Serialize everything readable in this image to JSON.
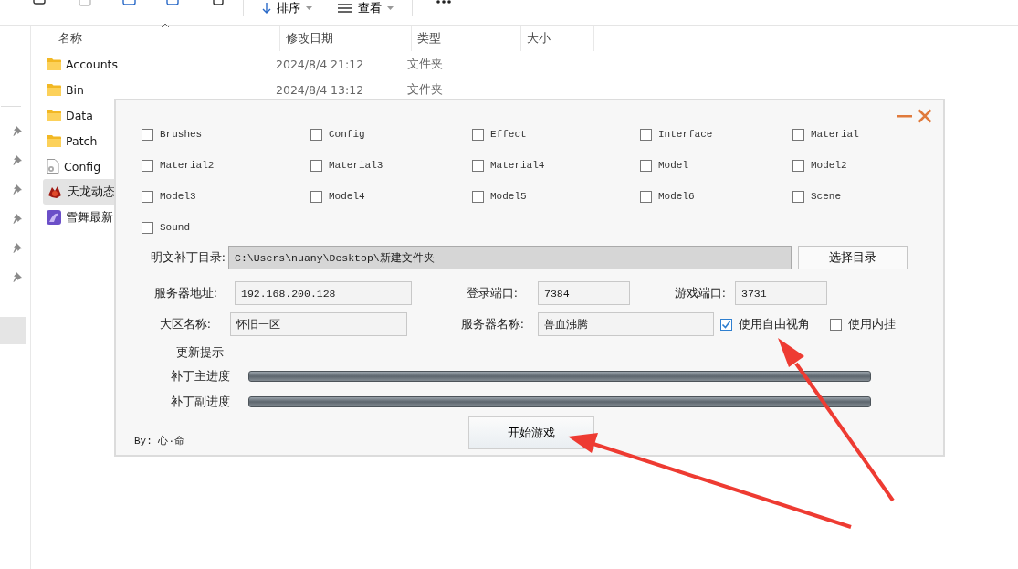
{
  "toolbar": {
    "items": [
      {
        "label": "排序"
      },
      {
        "label": "查看"
      }
    ]
  },
  "explorer": {
    "columns": [
      "名称",
      "修改日期",
      "类型",
      "大小"
    ],
    "rows": [
      {
        "name": "Accounts",
        "modified": "2024/8/4 21:12",
        "type": "文件夹",
        "kind": "folder",
        "selected": false
      },
      {
        "name": "Bin",
        "modified": "2024/8/4 13:12",
        "type": "文件夹",
        "kind": "folder",
        "selected": false
      },
      {
        "name": "Data",
        "kind": "folder",
        "selected": false
      },
      {
        "name": "Patch",
        "kind": "folder",
        "selected": false
      },
      {
        "name": "Config",
        "kind": "config",
        "selected": false
      },
      {
        "name": "天龙动态",
        "kind": "game",
        "selected": true
      },
      {
        "name": "雪舞最新",
        "kind": "app",
        "selected": false
      }
    ]
  },
  "dialog": {
    "checkboxes": [
      {
        "label": "Brushes",
        "checked": false
      },
      {
        "label": "Config",
        "checked": false
      },
      {
        "label": "Effect",
        "checked": false
      },
      {
        "label": "Interface",
        "checked": false
      },
      {
        "label": "Material",
        "checked": false
      },
      {
        "label": "Material2",
        "checked": false
      },
      {
        "label": "Material3",
        "checked": false
      },
      {
        "label": "Material4",
        "checked": false
      },
      {
        "label": "Model",
        "checked": false
      },
      {
        "label": "Model2",
        "checked": false
      },
      {
        "label": "Model3",
        "checked": false
      },
      {
        "label": "Model4",
        "checked": false
      },
      {
        "label": "Model5",
        "checked": false
      },
      {
        "label": "Model6",
        "checked": false
      },
      {
        "label": "Scene",
        "checked": false
      },
      {
        "label": "Sound",
        "checked": false
      }
    ],
    "patch_dir": {
      "label": "明文补丁目录:",
      "value": "C:\\Users\\nuany\\Desktop\\新建文件夹",
      "button": "选择目录"
    },
    "server_address": {
      "label": "服务器地址:",
      "value": "192.168.200.128"
    },
    "login_port": {
      "label": "登录端口:",
      "value": "7384"
    },
    "game_port": {
      "label": "游戏端口:",
      "value": "3731"
    },
    "region_name": {
      "label": "大区名称:",
      "value": "怀旧一区"
    },
    "server_name": {
      "label": "服务器名称:",
      "value": "兽血沸腾"
    },
    "options": [
      {
        "label": "使用自由视角",
        "checked": true
      },
      {
        "label": "使用内挂",
        "checked": false
      }
    ],
    "update_hint": "更新提示",
    "progress": [
      {
        "label": "补丁主进度",
        "level": 0
      },
      {
        "label": "补丁副进度",
        "level": 0
      }
    ],
    "author": "By: 心·命",
    "start_button": "开始游戏"
  }
}
